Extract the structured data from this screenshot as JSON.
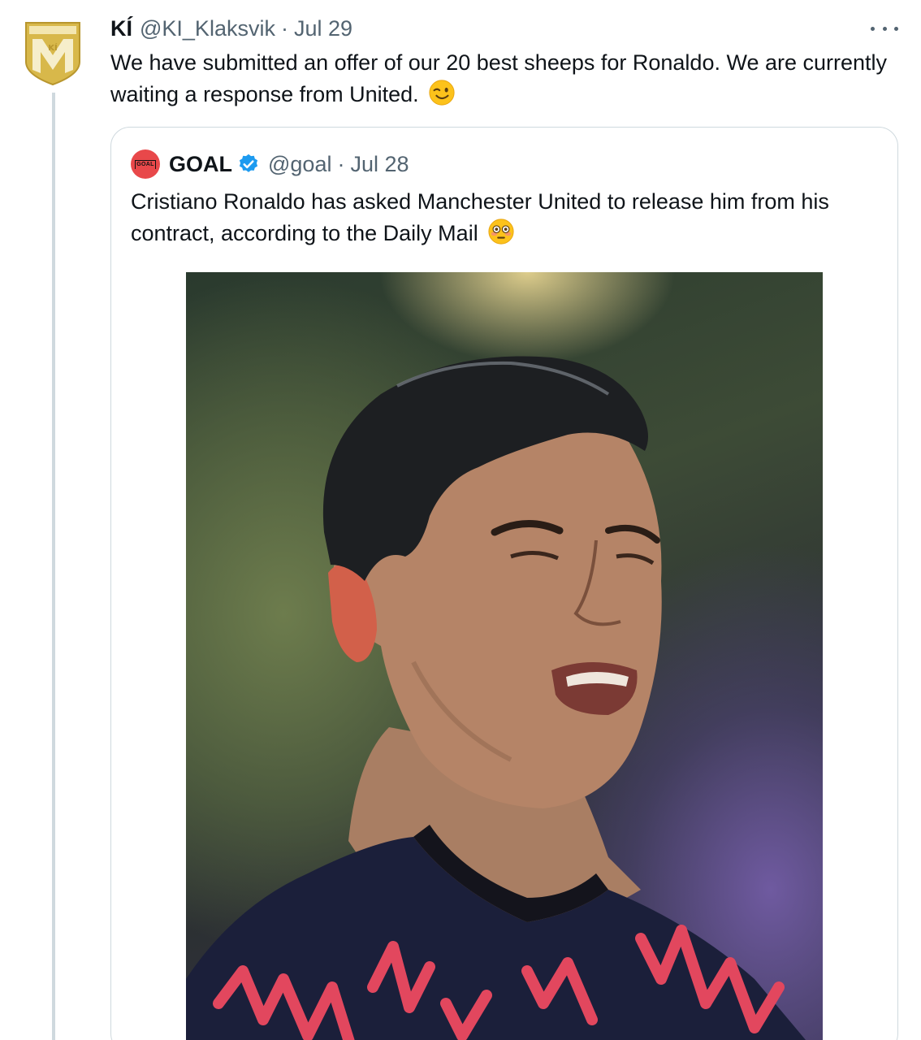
{
  "tweet": {
    "author_name": "KÍ",
    "handle": "@KI_Klaksvik",
    "separator": "·",
    "date": "Jul 29",
    "text": "We have submitted an offer of our 20 best sheeps for Ronaldo. We are currently waiting a response from United.",
    "emoji": "winking-face",
    "avatar_icon": "club-crest-icon"
  },
  "quoted_tweet": {
    "author_name": "GOAL",
    "avatar_label": "GOAL",
    "verified": true,
    "handle": "@goal",
    "separator": "·",
    "date": "Jul 28",
    "text": "Cristiano Ronaldo has asked Manchester United to release him from his contract, according to the Daily Mail",
    "emoji": "flushed-face",
    "media": "photo of footballer grimacing"
  },
  "colors": {
    "text_primary": "#0f1419",
    "text_secondary": "#536471",
    "border": "#cfd9de",
    "verified_blue": "#1d9bf0",
    "goal_red": "#e8484a",
    "crest_gold": "#d8b84a"
  }
}
